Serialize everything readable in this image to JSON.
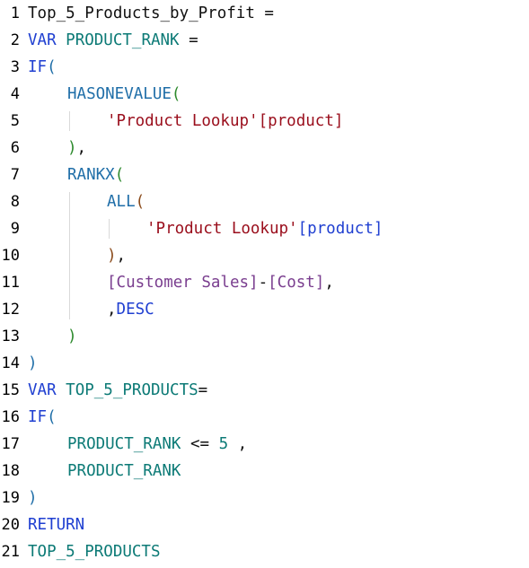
{
  "editor": {
    "lines": [
      {
        "number": "1",
        "indent": 0,
        "tokens": [
          {
            "t": "Top_5_Products_by_Profit ",
            "c": "plain"
          },
          {
            "t": "=",
            "c": "op"
          }
        ]
      },
      {
        "number": "2",
        "indent": 0,
        "tokens": [
          {
            "t": "VAR ",
            "c": "kw"
          },
          {
            "t": "PRODUCT_RANK",
            "c": "var"
          },
          {
            "t": " =",
            "c": "op"
          }
        ]
      },
      {
        "number": "3",
        "indent": 0,
        "tokens": [
          {
            "t": "IF",
            "c": "kw"
          },
          {
            "t": "(",
            "c": "p1"
          }
        ]
      },
      {
        "number": "4",
        "indent": 1,
        "tokens": [
          {
            "t": "HASONEVALUE",
            "c": "fn"
          },
          {
            "t": "(",
            "c": "p2"
          }
        ]
      },
      {
        "number": "5",
        "indent": 2,
        "tokens": [
          {
            "t": "'Product Lookup'",
            "c": "str"
          },
          {
            "t": "[product]",
            "c": "str"
          }
        ]
      },
      {
        "number": "6",
        "indent": 1,
        "tokens": [
          {
            "t": ")",
            "c": "p2"
          },
          {
            "t": ",",
            "c": "op"
          }
        ]
      },
      {
        "number": "7",
        "indent": 1,
        "tokens": [
          {
            "t": "RANKX",
            "c": "fn"
          },
          {
            "t": "(",
            "c": "p2"
          }
        ]
      },
      {
        "number": "8",
        "indent": 2,
        "tokens": [
          {
            "t": "ALL",
            "c": "fn"
          },
          {
            "t": "(",
            "c": "p3"
          }
        ]
      },
      {
        "number": "9",
        "indent": 3,
        "tokens": [
          {
            "t": "'Product Lookup'",
            "c": "str"
          },
          {
            "t": "[product]",
            "c": "col"
          }
        ]
      },
      {
        "number": "10",
        "indent": 2,
        "tokens": [
          {
            "t": ")",
            "c": "p3"
          },
          {
            "t": ",",
            "c": "op"
          }
        ]
      },
      {
        "number": "11",
        "indent": 2,
        "tokens": [
          {
            "t": "[Customer Sales]",
            "c": "meas"
          },
          {
            "t": "-",
            "c": "op"
          },
          {
            "t": "[Cost]",
            "c": "meas"
          },
          {
            "t": ",",
            "c": "op"
          }
        ]
      },
      {
        "number": "12",
        "indent": 2,
        "tokens": [
          {
            "t": ",",
            "c": "op"
          },
          {
            "t": "DESC",
            "c": "kw"
          }
        ]
      },
      {
        "number": "13",
        "indent": 1,
        "tokens": [
          {
            "t": ")",
            "c": "p2"
          }
        ]
      },
      {
        "number": "14",
        "indent": 0,
        "tokens": [
          {
            "t": ")",
            "c": "p1"
          }
        ]
      },
      {
        "number": "15",
        "indent": 0,
        "tokens": [
          {
            "t": "VAR ",
            "c": "kw"
          },
          {
            "t": "TOP_5_PRODUCTS",
            "c": "var"
          },
          {
            "t": "=",
            "c": "op"
          }
        ]
      },
      {
        "number": "16",
        "indent": 0,
        "tokens": [
          {
            "t": "IF",
            "c": "kw"
          },
          {
            "t": "(",
            "c": "p1"
          }
        ]
      },
      {
        "number": "17",
        "indent": 1,
        "tokens": [
          {
            "t": "PRODUCT_RANK",
            "c": "var"
          },
          {
            "t": " <= ",
            "c": "op"
          },
          {
            "t": "5",
            "c": "num"
          },
          {
            "t": " ,",
            "c": "op"
          }
        ]
      },
      {
        "number": "18",
        "indent": 1,
        "tokens": [
          {
            "t": "PRODUCT_RANK",
            "c": "var"
          }
        ]
      },
      {
        "number": "19",
        "indent": 0,
        "tokens": [
          {
            "t": ")",
            "c": "p1"
          }
        ]
      },
      {
        "number": "20",
        "indent": 0,
        "tokens": [
          {
            "t": "RETURN",
            "c": "kw"
          }
        ]
      },
      {
        "number": "21",
        "indent": 0,
        "tokens": [
          {
            "t": "TOP_5_PRODUCTS",
            "c": "var"
          }
        ]
      }
    ]
  }
}
